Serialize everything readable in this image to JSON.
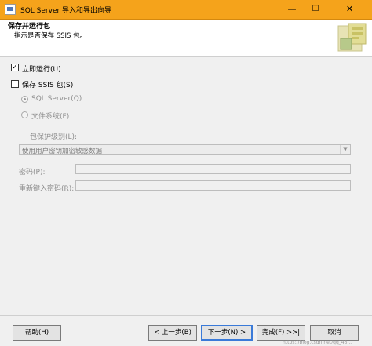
{
  "window": {
    "title": "SQL Server 导入和导出向导",
    "minimize_glyph": "—",
    "maximize_glyph": "☐",
    "close_glyph": "✕"
  },
  "header": {
    "title": "保存并运行包",
    "subtitle": "指示是否保存 SSIS 包。"
  },
  "options": {
    "run_now": {
      "label": "立即运行(U)",
      "checked": true
    },
    "save_ssis": {
      "label": "保存 SSIS 包(S)",
      "checked": false
    },
    "sql_server": {
      "label": "SQL Server(Q)",
      "selected": true,
      "enabled": false
    },
    "file_system": {
      "label": "文件系统(F)",
      "selected": false,
      "enabled": false
    }
  },
  "protection": {
    "label": "包保护级别(L):",
    "value": "使用用户密钥加密敏感数据"
  },
  "password": {
    "label": "密码(P):",
    "value": ""
  },
  "confirm_password": {
    "label": "重新键入密码(R):",
    "value": ""
  },
  "buttons": {
    "help": "帮助(H)",
    "back": "< 上一步(B)",
    "next": "下一步(N) >",
    "finish": "完成(F) >>|",
    "cancel": "取消"
  },
  "watermark": "https://blog.csdn.net/qq_43..."
}
